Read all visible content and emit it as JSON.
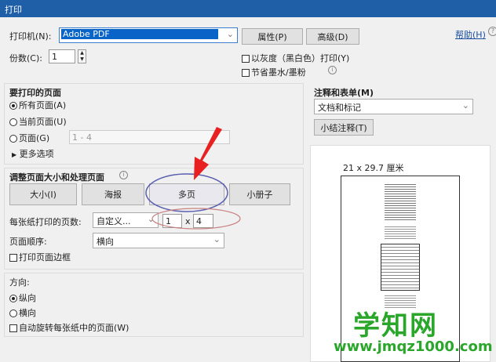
{
  "window": {
    "title": "打印"
  },
  "printer": {
    "label": "打印机(N):",
    "value": "Adobe PDF",
    "properties": "属性(P)",
    "advanced": "高级(D)",
    "help": "帮助(H)"
  },
  "copies": {
    "label": "份数(C):",
    "value": "1"
  },
  "options": {
    "grayscale": "以灰度（黑白色）打印(Y)",
    "save_ink": "节省墨水/墨粉"
  },
  "pages": {
    "title": "要打印的页面",
    "all": "所有页面(A)",
    "current": "当前页面(U)",
    "range": "页面(G)",
    "range_value": "1 - 4",
    "more": "更多选项"
  },
  "sizing": {
    "title": "调整页面大小和处理页面",
    "size": "大小(I)",
    "poster": "海报",
    "multiple": "多页",
    "booklet": "小册子",
    "pages_per_sheet_label": "每张纸打印的页数:",
    "pages_per_sheet": "自定义...",
    "cols": "1",
    "x": "x",
    "rows": "4",
    "order_label": "页面顺序:",
    "order": "横向",
    "border": "打印页面边框"
  },
  "orientation": {
    "title": "方向:",
    "portrait": "纵向",
    "landscape": "横向",
    "auto_rotate": "自动旋转每张纸中的页面(W)"
  },
  "comments": {
    "title": "注释和表单(M)",
    "value": "文档和标记",
    "summarize": "小结注释(T)"
  },
  "preview": {
    "size": "21 x 29.7 厘米"
  },
  "watermark": {
    "name": "学知网",
    "url": "www.jmqz1000.com"
  }
}
